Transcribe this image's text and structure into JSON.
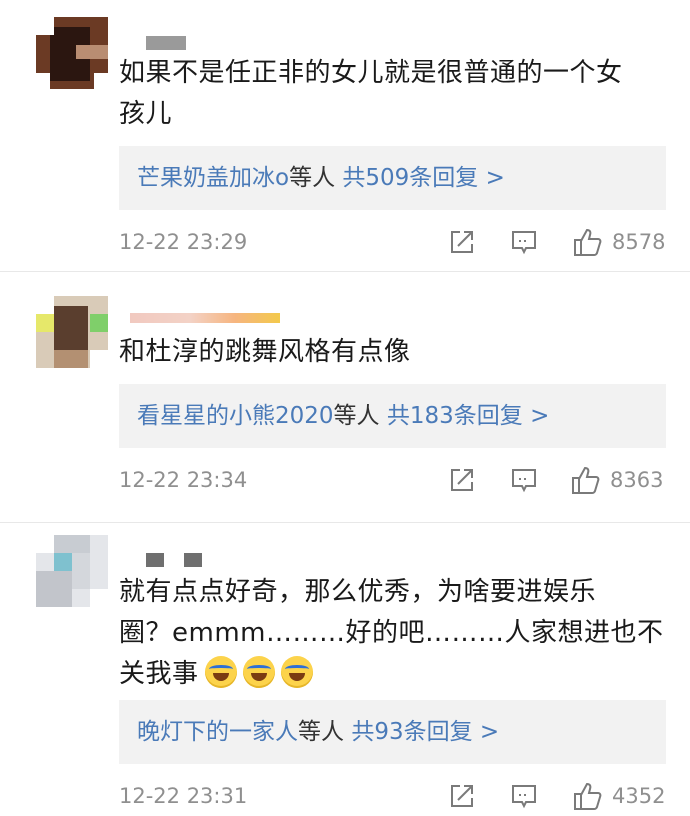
{
  "comments": [
    {
      "text": "如果不是任正非的女儿就是很普通的一个女\n孩儿",
      "reply_user": "芒果奶盖加冰o",
      "reply_suffix": "等人",
      "reply_count": "共509条回复 >",
      "time": "12-22 23:29",
      "likes": "8578"
    },
    {
      "text": "和杜淳的跳舞风格有点像",
      "reply_user": "看星星的小熊2020",
      "reply_suffix": "等人",
      "reply_count": "共183条回复 >",
      "time": "12-22 23:34",
      "likes": "8363"
    },
    {
      "text": "就有点点好奇，那么优秀，为啥要进娱乐\n圈？emmm………好的吧………人家想进也不\n关我事",
      "reply_user": "晚灯下的一家人",
      "reply_suffix": "等人",
      "reply_count": "共93条回复 >",
      "time": "12-22 23:31",
      "likes": "4352"
    }
  ],
  "icons": {
    "share": "share-icon",
    "comment": "comment-icon",
    "like": "thumbs-up-icon",
    "emoji": "laugh-cry-emoji-icon"
  },
  "colors": {
    "link": "#4a7ab8",
    "meta": "#8f8f8f",
    "reply_bg": "#f2f2f2"
  }
}
